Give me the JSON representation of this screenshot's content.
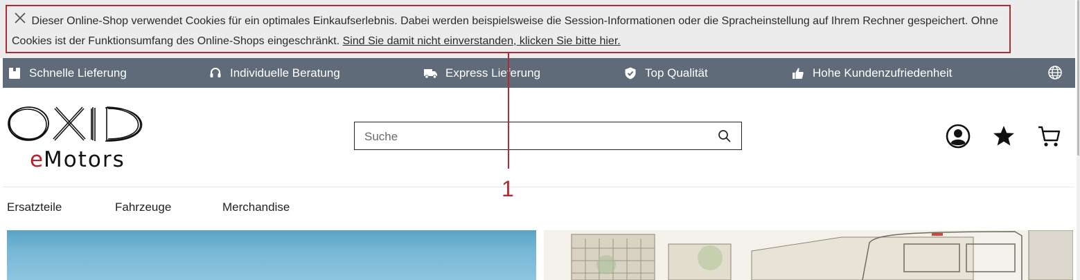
{
  "cookie_banner": {
    "message": "Dieser Online-Shop verwendet Cookies für ein optimales Einkaufserlebnis. Dabei werden beispielsweise die Session-Informationen oder die Spracheinstellung auf Ihrem Rechner gespeichert. Ohne Cookies ist der Funktionsumfang des Online-Shops eingeschränkt.",
    "link_text": "Sind Sie damit nicht einverstanden, klicken Sie bitte hier."
  },
  "annotation": {
    "number": "1",
    "color": "#b22a32"
  },
  "usp_bar": {
    "background": "#5f6b78",
    "items": [
      {
        "label": "Schnelle Lieferung",
        "icon": "package-icon"
      },
      {
        "label": "Individuelle Beratung",
        "icon": "headset-icon"
      },
      {
        "label": "Express Lieferung",
        "icon": "truck-icon"
      },
      {
        "label": "Top Qualität",
        "icon": "shield-check-icon"
      },
      {
        "label": "Hohe Kundenzufriedenheit",
        "icon": "thumbs-up-icon"
      }
    ],
    "language_icon": "globe-icon"
  },
  "header": {
    "logo": {
      "line1": "OXID",
      "line2_accent": "e",
      "line2_rest": "Motors",
      "accent_color": "#c11b27"
    },
    "search": {
      "placeholder": "Suche",
      "value": ""
    },
    "icons": [
      "account-icon",
      "wishlist-star-icon",
      "cart-icon"
    ]
  },
  "nav": {
    "items": [
      "Ersatzteile",
      "Fahrzeuge",
      "Merchandise"
    ]
  }
}
